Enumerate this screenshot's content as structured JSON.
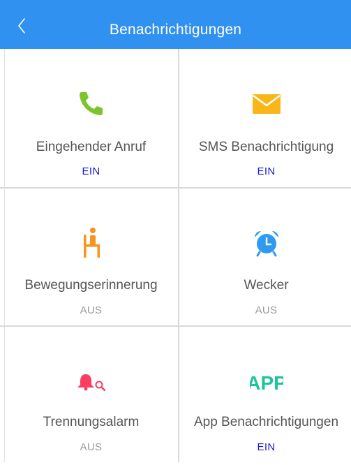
{
  "header": {
    "title": "Benachrichtigungen",
    "back_icon": "chevron-left-icon",
    "background_color": "#3191f0"
  },
  "items": [
    {
      "label": "Eingehender Anruf",
      "status": "EIN",
      "icon": "phone-icon",
      "icon_color": "#7bc52b"
    },
    {
      "label": "SMS Benachrichtigung",
      "status": "EIN",
      "icon": "envelope-icon",
      "icon_color": "#f9b618"
    },
    {
      "label": "Bewegungserinnerung",
      "status": "AUS",
      "icon": "sitting-person-icon",
      "icon_color": "#f7941d"
    },
    {
      "label": "Wecker",
      "status": "AUS",
      "icon": "alarm-clock-icon",
      "icon_color": "#2e9bf0"
    },
    {
      "label": "Trennungsalarm",
      "status": "AUS",
      "icon": "bell-search-icon",
      "icon_color": "#fb3d5f"
    },
    {
      "label": "App Benachrichtigungen",
      "status": "EIN",
      "icon": "app-icon",
      "icon_color": "#1ec49a",
      "icon_text": "APP"
    }
  ],
  "status_colors": {
    "on": "#1a1ad6",
    "off": "#9a9a9a"
  }
}
